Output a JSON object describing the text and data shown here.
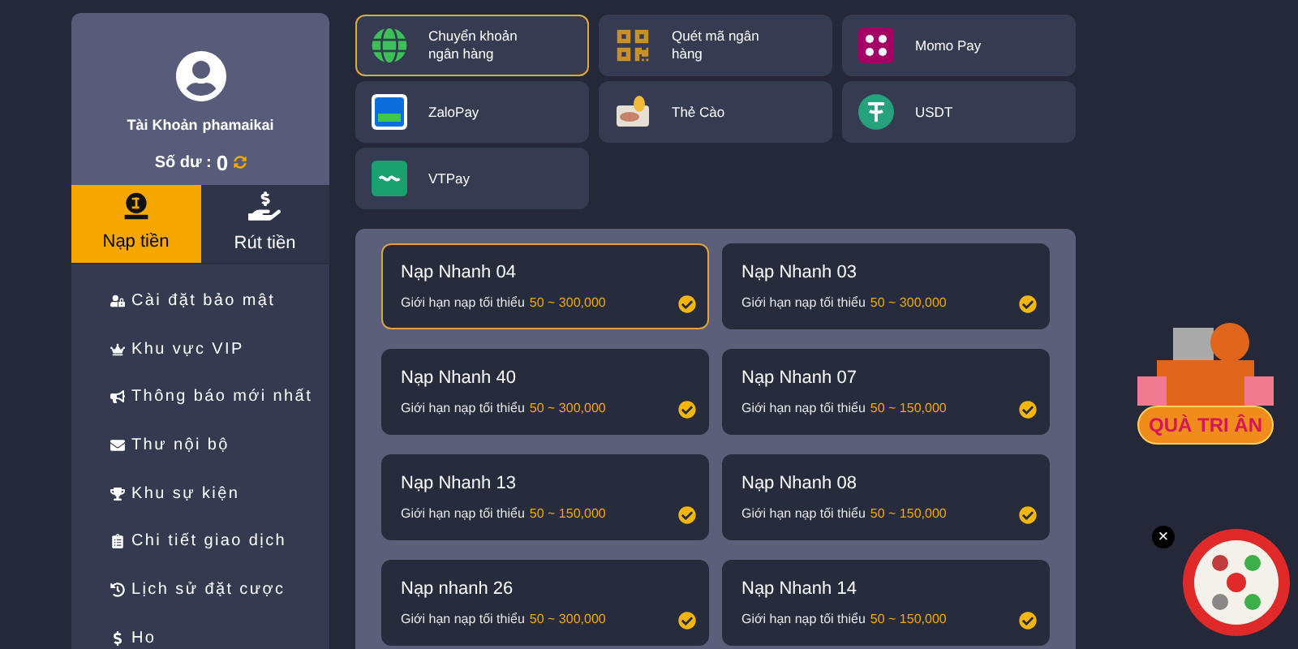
{
  "profile": {
    "account_label": "Tài Khoản",
    "username": "phamaikai",
    "balance_label": "Số dư :",
    "balance": "0"
  },
  "tabs": [
    {
      "label": "Nạp tiền",
      "kind": "deposit",
      "selected": true
    },
    {
      "label": "Rút tiền",
      "kind": "withdraw",
      "selected": false
    }
  ],
  "menu": [
    {
      "label": "Cài đặt bảo mật",
      "kind": "user-lock"
    },
    {
      "label": "Khu vực VIP",
      "kind": "crown"
    },
    {
      "label": "Thông báo mới nhất",
      "kind": "megaphone"
    },
    {
      "label": "Thư nội bộ",
      "kind": "mail"
    },
    {
      "label": "Khu sự kiện",
      "kind": "trophy"
    },
    {
      "label": "Chi tiết giao dịch",
      "kind": "clipboard"
    },
    {
      "label": "Lịch sử đặt cược",
      "kind": "history"
    },
    {
      "label": "Ho",
      "kind": "dollar"
    }
  ],
  "methods": [
    {
      "label": "Chuyển khoản ngân hàng",
      "kind": "globe",
      "selected": true
    },
    {
      "label": "Quét mã ngân hàng",
      "kind": "qr",
      "selected": false
    },
    {
      "label": "Momo Pay",
      "kind": "momo",
      "selected": false
    },
    {
      "label": "ZaloPay",
      "kind": "zalo",
      "selected": false
    },
    {
      "label": "Thẻ Cào",
      "kind": "card",
      "selected": false
    },
    {
      "label": "USDT",
      "kind": "tether",
      "selected": false
    },
    {
      "label": "VTPay",
      "kind": "vtpay",
      "selected": false
    }
  ],
  "channels": [
    {
      "name": "Nạp Nhanh 04",
      "limit_label": "Giới hạn nạp tối thiểu",
      "range": "50 ~ 300,000",
      "selected": true
    },
    {
      "name": "Nạp Nhanh 03",
      "limit_label": "Giới hạn nạp tối thiểu",
      "range": "50 ~ 300,000",
      "selected": false
    },
    {
      "name": "Nạp Nhanh 40",
      "limit_label": "Giới hạn nạp tối thiểu",
      "range": "50 ~ 300,000",
      "selected": false
    },
    {
      "name": "Nạp Nhanh 07",
      "limit_label": "Giới hạn nạp tối thiểu",
      "range": "50 ~ 150,000",
      "selected": false
    },
    {
      "name": "Nạp Nhanh 13",
      "limit_label": "Giới hạn nạp tối thiểu",
      "range": "50 ~ 150,000",
      "selected": false
    },
    {
      "name": "Nạp Nhanh 08",
      "limit_label": "Giới hạn nạp tối thiểu",
      "range": "50 ~ 150,000",
      "selected": false
    },
    {
      "name": "Nạp nhanh 26",
      "limit_label": "Giới hạn nạp tối thiểu",
      "range": "50 ~ 300,000",
      "selected": false
    },
    {
      "name": "Nạp Nhanh 14",
      "limit_label": "Giới hạn nạp tối thiểu",
      "range": "50 ~ 150,000",
      "selected": false
    }
  ],
  "promo": {
    "label": "QUÀ TRI ÂN",
    "close": "×"
  }
}
